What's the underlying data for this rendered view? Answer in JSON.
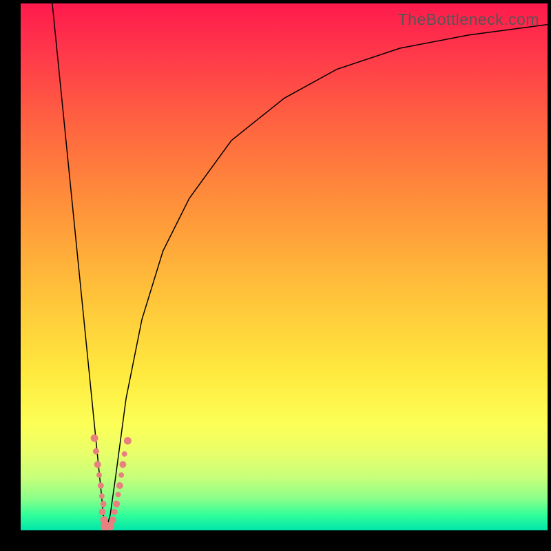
{
  "watermark": "TheBottleneck.com",
  "colors": {
    "frame_bg": "#000000",
    "curve_stroke": "#000000",
    "dot_fill": "#e88080",
    "gradient_stops": [
      {
        "offset": 0,
        "color": "#ff1a4d"
      },
      {
        "offset": 0.1,
        "color": "#ff3a4a"
      },
      {
        "offset": 0.25,
        "color": "#ff6a3f"
      },
      {
        "offset": 0.4,
        "color": "#ff963a"
      },
      {
        "offset": 0.55,
        "color": "#ffc23a"
      },
      {
        "offset": 0.7,
        "color": "#ffe93e"
      },
      {
        "offset": 0.8,
        "color": "#fcff57"
      },
      {
        "offset": 0.85,
        "color": "#eaff68"
      },
      {
        "offset": 0.9,
        "color": "#c7ff7a"
      },
      {
        "offset": 0.94,
        "color": "#8aff8a"
      },
      {
        "offset": 0.97,
        "color": "#33ff99"
      },
      {
        "offset": 1.0,
        "color": "#00e5aa"
      }
    ]
  },
  "chart_data": {
    "type": "line",
    "title": "",
    "xlabel": "",
    "ylabel": "",
    "xlim": [
      0,
      100
    ],
    "ylim": [
      0,
      100
    ],
    "series": [
      {
        "name": "left-branch",
        "x": [
          6,
          8,
          10,
          12,
          14,
          15,
          15.5,
          15.8,
          16,
          16.2
        ],
        "y": [
          100,
          80,
          60,
          40,
          20,
          10,
          5,
          2,
          1,
          0
        ]
      },
      {
        "name": "right-branch",
        "x": [
          16.2,
          17,
          18,
          20,
          23,
          27,
          32,
          40,
          50,
          60,
          72,
          85,
          100
        ],
        "y": [
          0,
          3,
          10,
          25,
          40,
          53,
          63,
          74,
          82,
          87.5,
          91.5,
          94,
          96
        ]
      }
    ],
    "scatter": {
      "name": "cluster-dots",
      "points": [
        {
          "x": 14.0,
          "y": 17.5,
          "r": 5.5
        },
        {
          "x": 14.3,
          "y": 15.0,
          "r": 4.5
        },
        {
          "x": 14.6,
          "y": 12.5,
          "r": 5.0
        },
        {
          "x": 14.9,
          "y": 10.5,
          "r": 4.0
        },
        {
          "x": 15.2,
          "y": 8.5,
          "r": 4.5
        },
        {
          "x": 15.4,
          "y": 6.5,
          "r": 4.0
        },
        {
          "x": 15.7,
          "y": 5.0,
          "r": 4.5
        },
        {
          "x": 15.5,
          "y": 3.5,
          "r": 5.0
        },
        {
          "x": 15.8,
          "y": 2.0,
          "r": 5.5
        },
        {
          "x": 16.1,
          "y": 0.8,
          "r": 7.0
        },
        {
          "x": 17.0,
          "y": 0.8,
          "r": 6.0
        },
        {
          "x": 17.5,
          "y": 2.0,
          "r": 5.0
        },
        {
          "x": 17.8,
          "y": 3.5,
          "r": 4.5
        },
        {
          "x": 18.2,
          "y": 5.0,
          "r": 5.0
        },
        {
          "x": 18.5,
          "y": 6.8,
          "r": 4.0
        },
        {
          "x": 18.8,
          "y": 8.5,
          "r": 5.0
        },
        {
          "x": 19.1,
          "y": 10.5,
          "r": 4.0
        },
        {
          "x": 19.4,
          "y": 12.5,
          "r": 5.0
        },
        {
          "x": 19.7,
          "y": 14.5,
          "r": 4.0
        },
        {
          "x": 20.3,
          "y": 17.0,
          "r": 5.5
        }
      ]
    }
  }
}
